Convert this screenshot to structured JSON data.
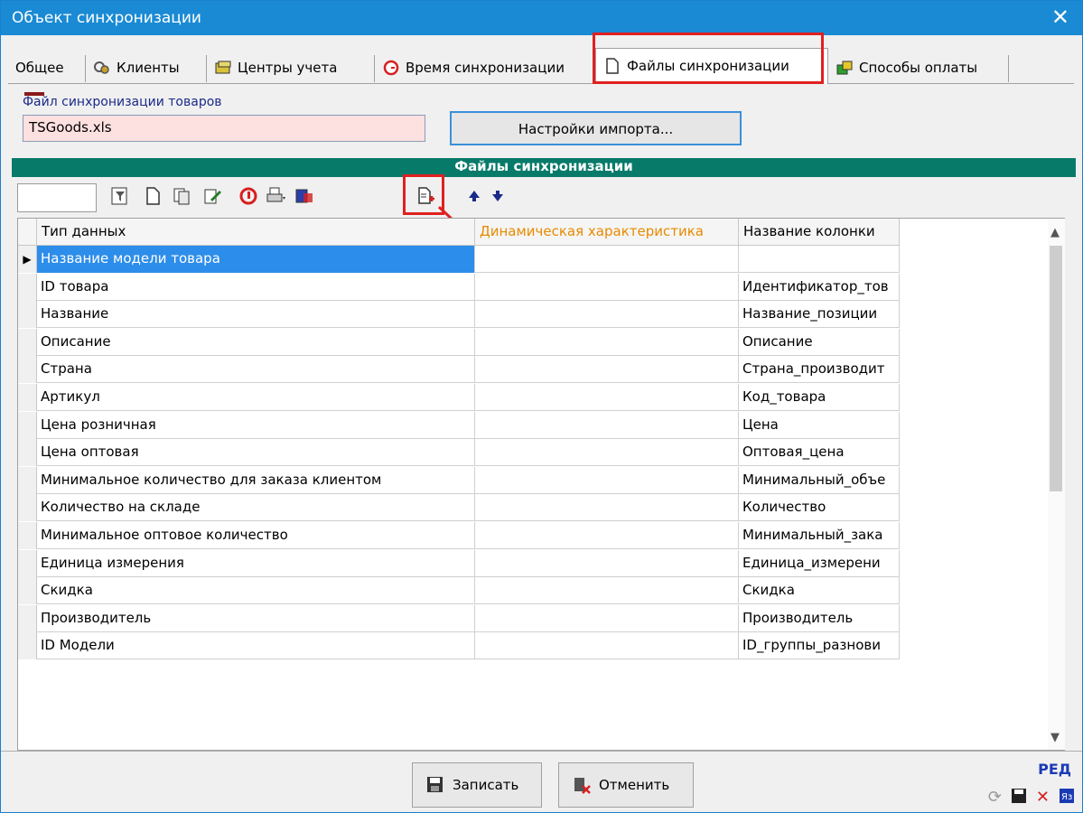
{
  "window": {
    "title": "Объект синхронизации",
    "close_glyph": "✕"
  },
  "tabs": [
    {
      "label": "Общее",
      "icon": ""
    },
    {
      "label": "Клиенты",
      "icon": "clients-icon"
    },
    {
      "label": "Центры учета",
      "icon": "accounting-centers-icon"
    },
    {
      "label": "Время синхронизации",
      "icon": "clock-icon"
    },
    {
      "label": "Файлы синхронизации",
      "icon": "file-icon",
      "active": true
    },
    {
      "label": "Способы оплаты",
      "icon": "payment-methods-icon"
    }
  ],
  "sync_file": {
    "label": "Файл синхронизации товаров",
    "value": "TSGoods.xls",
    "import_button": "Настройки импорта..."
  },
  "section": {
    "title": "Файлы синхронизации"
  },
  "annotation": {
    "number": "1",
    "color": "#e02020"
  },
  "grid": {
    "columns": [
      "Тип данных",
      "Динамическая характеристика",
      "Название колонки"
    ],
    "rows": [
      [
        "Название модели товара",
        "",
        ""
      ],
      [
        "ID товара",
        "",
        "Идентификатор_тов"
      ],
      [
        "Название",
        "",
        "Название_позиции"
      ],
      [
        "Описание",
        "",
        "Описание"
      ],
      [
        "Страна",
        "",
        "Страна_производит"
      ],
      [
        "Артикул",
        "",
        "Код_товара"
      ],
      [
        "Цена розничная",
        "",
        "Цена"
      ],
      [
        "Цена оптовая",
        "",
        "Оптовая_цена"
      ],
      [
        "Минимальное количество для заказа клиентом",
        "",
        "Минимальный_объе"
      ],
      [
        "Количество на складе",
        "",
        "Количество"
      ],
      [
        "Минимальное оптовое количество",
        "",
        "Минимальный_зака"
      ],
      [
        "Единица измерения",
        "",
        "Единица_измерени"
      ],
      [
        "Скидка",
        "",
        "Скидка"
      ],
      [
        "Производитель",
        "",
        "Производитель"
      ],
      [
        "ID Модели",
        "",
        "ID_группы_разнови"
      ]
    ]
  },
  "footer": {
    "save": "Записать",
    "cancel": "Отменить",
    "mode": "РЕД"
  },
  "colors": {
    "titlebar": "#1a8ad4",
    "section_header": "#087a6a",
    "selected_row": "#2d8dea",
    "highlight_column_header": "#e88a00"
  }
}
